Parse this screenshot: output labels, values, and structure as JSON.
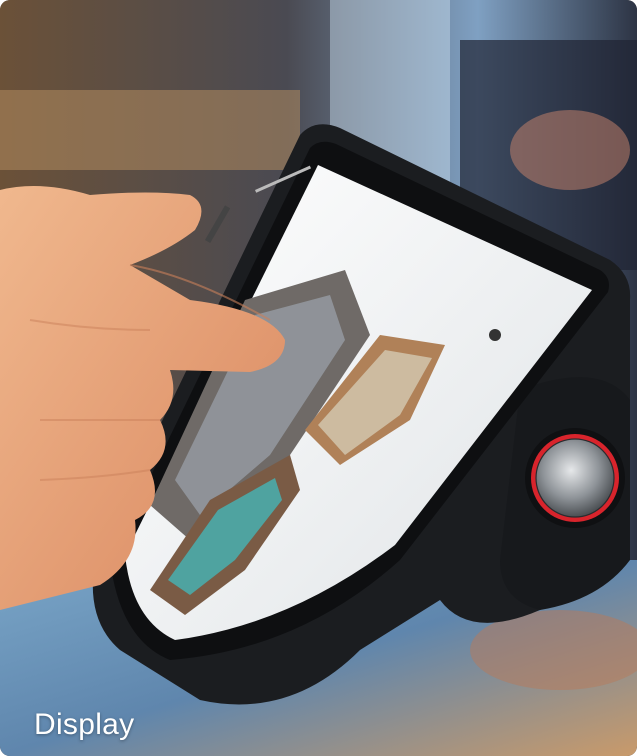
{
  "caption": "Display",
  "colors": {
    "device_body": "#1b1d20",
    "screen_bezel": "#0e0f11",
    "screen_bg": "#f2f2f0",
    "knob_ring": "#d8242c",
    "knob_metal": "#9aa0a6",
    "skin": "#e6a77e"
  },
  "icons": [
    "rotary-knob-icon"
  ]
}
